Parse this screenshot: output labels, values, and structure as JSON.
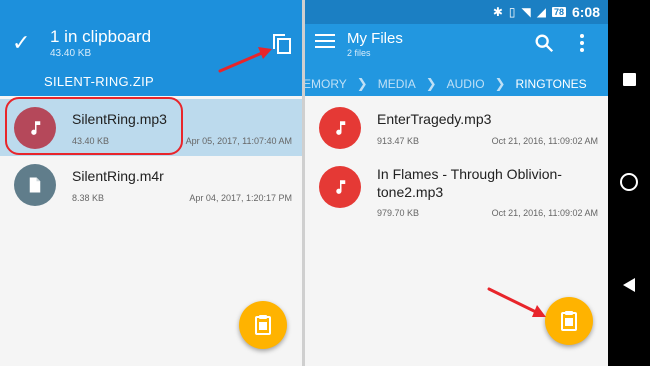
{
  "left": {
    "toolbar": {
      "title": "1 in clipboard",
      "subtitle": "43.40 KB",
      "clipboard_item": "SILENT-RING.ZIP"
    },
    "files": [
      {
        "name": "SilentRing.mp3",
        "size": "43.40 KB",
        "date": "Apr 05, 2017, 11:07:40 AM",
        "type": "audio",
        "icon_color": "#b5485a",
        "selected": true
      },
      {
        "name": "SilentRing.m4r",
        "size": "8.38 KB",
        "date": "Apr 04, 2017, 1:20:17 PM",
        "type": "file",
        "icon_color": "#607d8b",
        "selected": false
      }
    ],
    "fab_icon": "paste-icon"
  },
  "right": {
    "status_bar": {
      "time": "6:08",
      "battery": "78"
    },
    "toolbar": {
      "title": "My Files",
      "subtitle": "2 files"
    },
    "breadcrumbs": [
      "MEMORY",
      "MEDIA",
      "AUDIO",
      "RINGTONES"
    ],
    "files": [
      {
        "name": "EnterTragedy.mp3",
        "size": "913.47 KB",
        "date": "Oct 21, 2016, 11:09:02 AM",
        "type": "audio",
        "icon_color": "#e53935"
      },
      {
        "name_line1": "In Flames - Through Oblivion-",
        "name_line2": "tone2.mp3",
        "size": "979.70 KB",
        "date": "Oct 21, 2016, 11:09:02 AM",
        "type": "audio",
        "icon_color": "#e53935"
      }
    ],
    "fab_icon": "paste-icon"
  },
  "colors": {
    "accent": "#1d90dc",
    "fab": "#ffb300",
    "annotation": "#e8252b"
  }
}
